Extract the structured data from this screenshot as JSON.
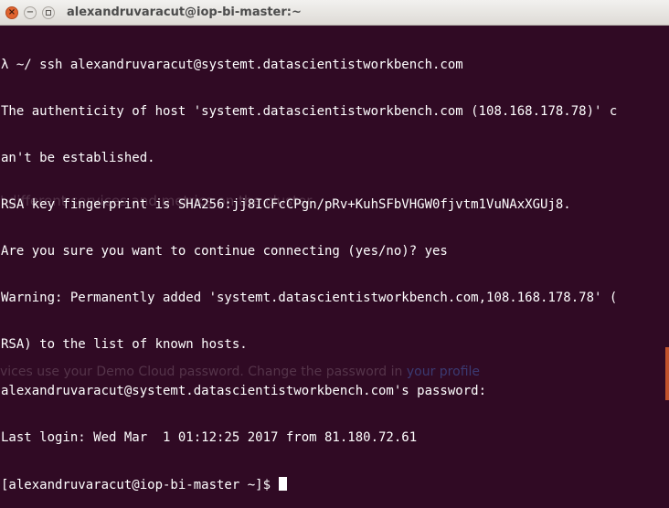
{
  "window": {
    "title": "alexandruvaracut@iop-bi-master:~",
    "close_glyph": "×",
    "minimize_glyph": "−"
  },
  "terminal": {
    "lines": [
      "λ ~/ ssh alexandruvaracut@systemt.datascientistworkbench.com",
      "The authenticity of host 'systemt.datascientistworkbench.com (108.168.178.78)' c",
      "an't be established.",
      "RSA key fingerprint is SHA256:jj8ICFcCPgn/pRv+KuhSFbVHGW0fjvtm1VuNAxXGUj8.",
      "Are you sure you want to continue connecting (yes/no)? yes",
      "Warning: Permanently added 'systemt.datascientistworkbench.com,108.168.178.78' (",
      "RSA) to the list of known hosts.",
      "alexandruvaracut@systemt.datascientistworkbench.com's password:",
      "Last login: Wed Mar  1 01:12:25 2017 from 81.180.72.61"
    ],
    "prompt": "[alexandruvaracut@iop-bi-master ~]$ "
  },
  "background_page": {
    "text1": "' different services and metrics on the cluster",
    "text2_prefix": "vices use your Demo Cloud password. Change the password in ",
    "text2_link": "your profile"
  },
  "colors": {
    "terminal_bg": "#300a24",
    "terminal_fg": "#ffffff",
    "close_button": "#e0632f"
  }
}
